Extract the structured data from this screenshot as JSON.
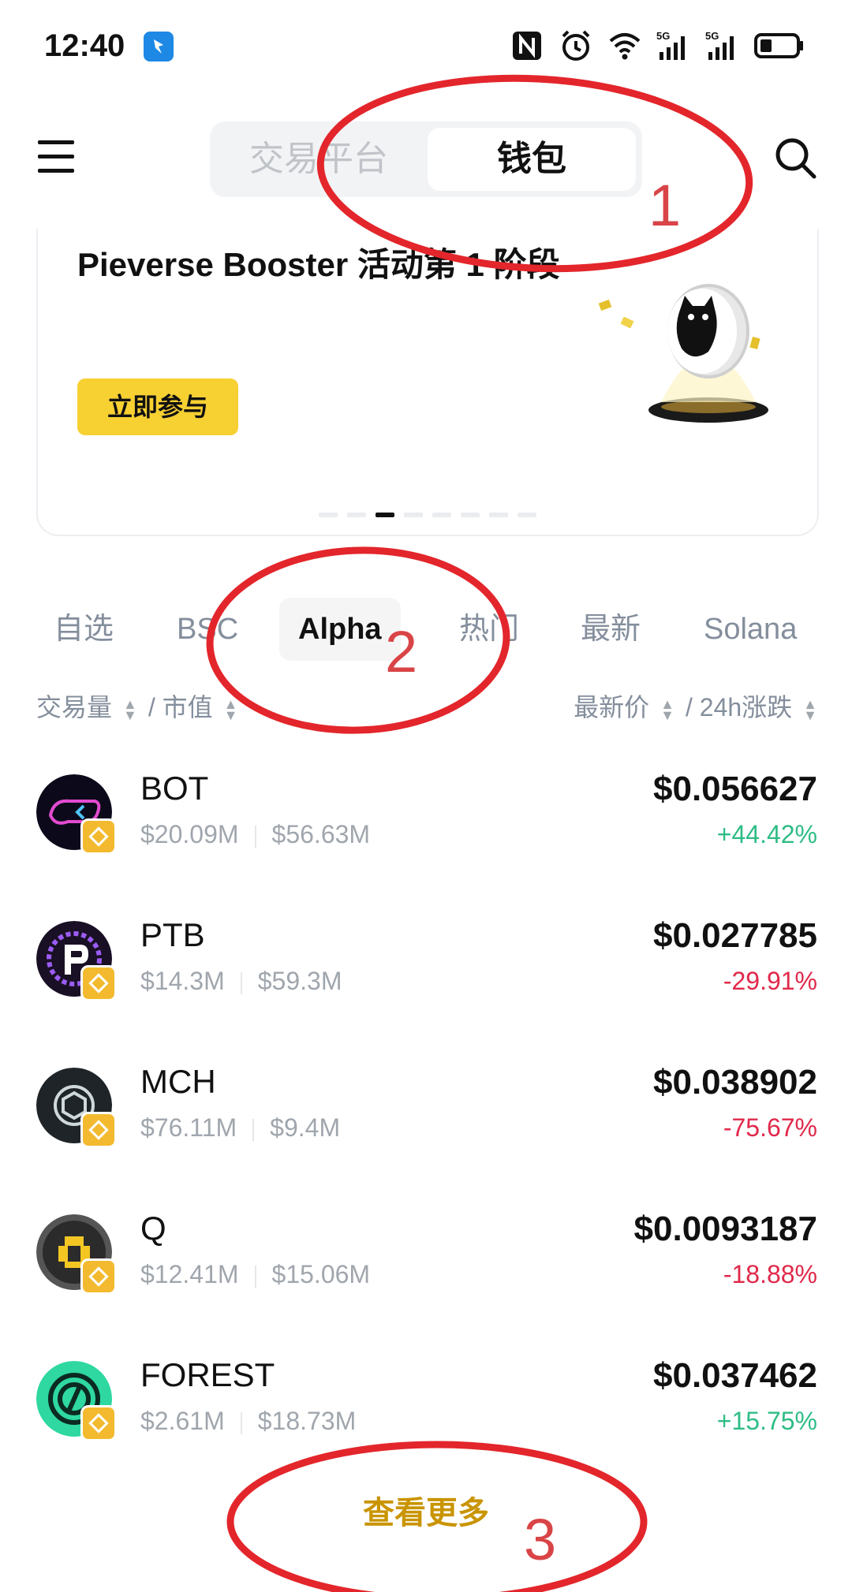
{
  "status_bar": {
    "time": "12:40",
    "icons": [
      "nfc-icon",
      "alarm-icon",
      "wifi-icon",
      "signal-5g-icon",
      "signal-5g-icon",
      "battery-icon"
    ]
  },
  "header": {
    "tabs": [
      {
        "label": "交易平台",
        "active": false
      },
      {
        "label": "钱包",
        "active": true
      }
    ]
  },
  "banner": {
    "title": "Pieverse Booster 活动第 1 阶段",
    "button_label": "立即参与",
    "page_count": 8,
    "active_page": 3
  },
  "category_tabs": [
    {
      "label": "自选",
      "active": false
    },
    {
      "label": "BSC",
      "active": false
    },
    {
      "label": "Alpha",
      "active": true
    },
    {
      "label": "热门",
      "active": false
    },
    {
      "label": "最新",
      "active": false
    },
    {
      "label": "Solana",
      "active": false
    }
  ],
  "sort_header": {
    "left_label_1": "交易量",
    "left_label_2": "市值",
    "right_label_1": "最新价",
    "right_label_2": "24h涨跌",
    "divider": "/"
  },
  "tokens": [
    {
      "symbol": "BOT",
      "volume": "$20.09M",
      "market_cap": "$56.63M",
      "price": "$0.056627",
      "change": "+44.42%",
      "direction": "up"
    },
    {
      "symbol": "PTB",
      "volume": "$14.3M",
      "market_cap": "$59.3M",
      "price": "$0.027785",
      "change": "-29.91%",
      "direction": "down"
    },
    {
      "symbol": "MCH",
      "volume": "$76.11M",
      "market_cap": "$9.4M",
      "price": "$0.038902",
      "change": "-75.67%",
      "direction": "down"
    },
    {
      "symbol": "Q",
      "volume": "$12.41M",
      "market_cap": "$15.06M",
      "price": "$0.0093187",
      "change": "-18.88%",
      "direction": "down"
    },
    {
      "symbol": "FOREST",
      "volume": "$2.61M",
      "market_cap": "$18.73M",
      "price": "$0.037462",
      "change": "+15.75%",
      "direction": "up"
    }
  ],
  "view_more_label": "查看更多",
  "annotations": {
    "labels": [
      "1",
      "2",
      "3"
    ],
    "color": "#e3262b"
  },
  "colors": {
    "accent_yellow": "#f7d032",
    "up_green": "#2ebd85",
    "down_red": "#e0294a",
    "link_gold": "#c99400"
  }
}
